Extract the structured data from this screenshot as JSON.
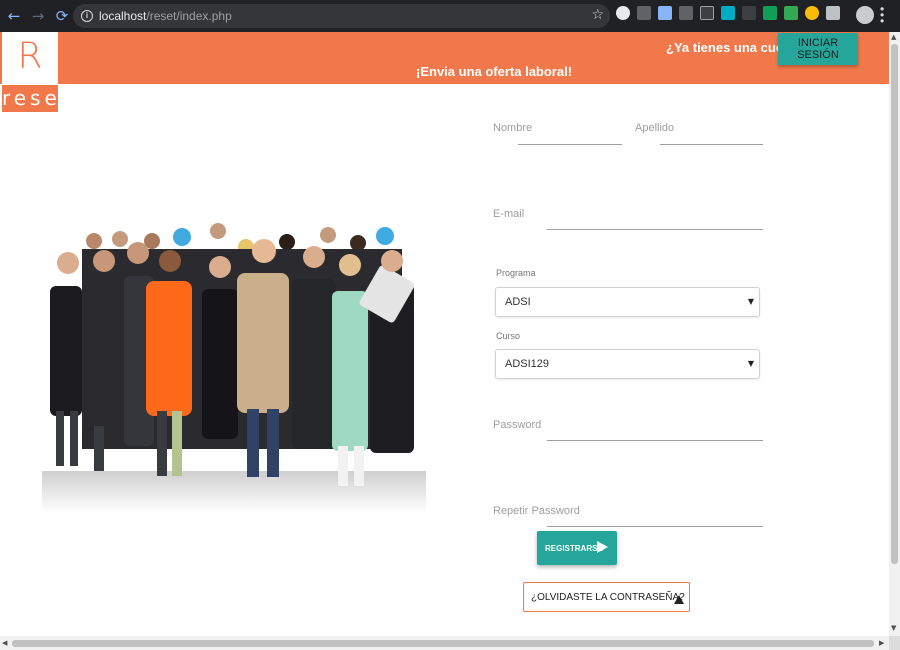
{
  "browser": {
    "back_glyph": "←",
    "forward_glyph": "→",
    "reload_glyph": "⟳",
    "url_host": "localhost",
    "url_path": "/reset/index.php",
    "star_glyph": "☆"
  },
  "header": {
    "logo_letter": "R",
    "logo_text": "reset",
    "account_prompt": "¿Ya tienes una cuenta?",
    "login_button": "INICIAR SESIÓN",
    "offer_link": "¡Envia una oferta laboral!"
  },
  "form": {
    "first_name_label": "Nombre",
    "last_name_label": "Apellido",
    "email_label": "E-mail",
    "program_label": "Programa",
    "program_value": "ADSI",
    "course_label": "Curso",
    "course_value": "ADSI129",
    "password_label": "Password",
    "repeat_password_label": "Repetir Password",
    "register_button": "REGISTRARSE",
    "forgot_button": "¿OLVIDASTE LA CONTRASEÑA?"
  },
  "colors": {
    "brand_orange": "#f0784a",
    "accent_teal": "#26a69a"
  }
}
